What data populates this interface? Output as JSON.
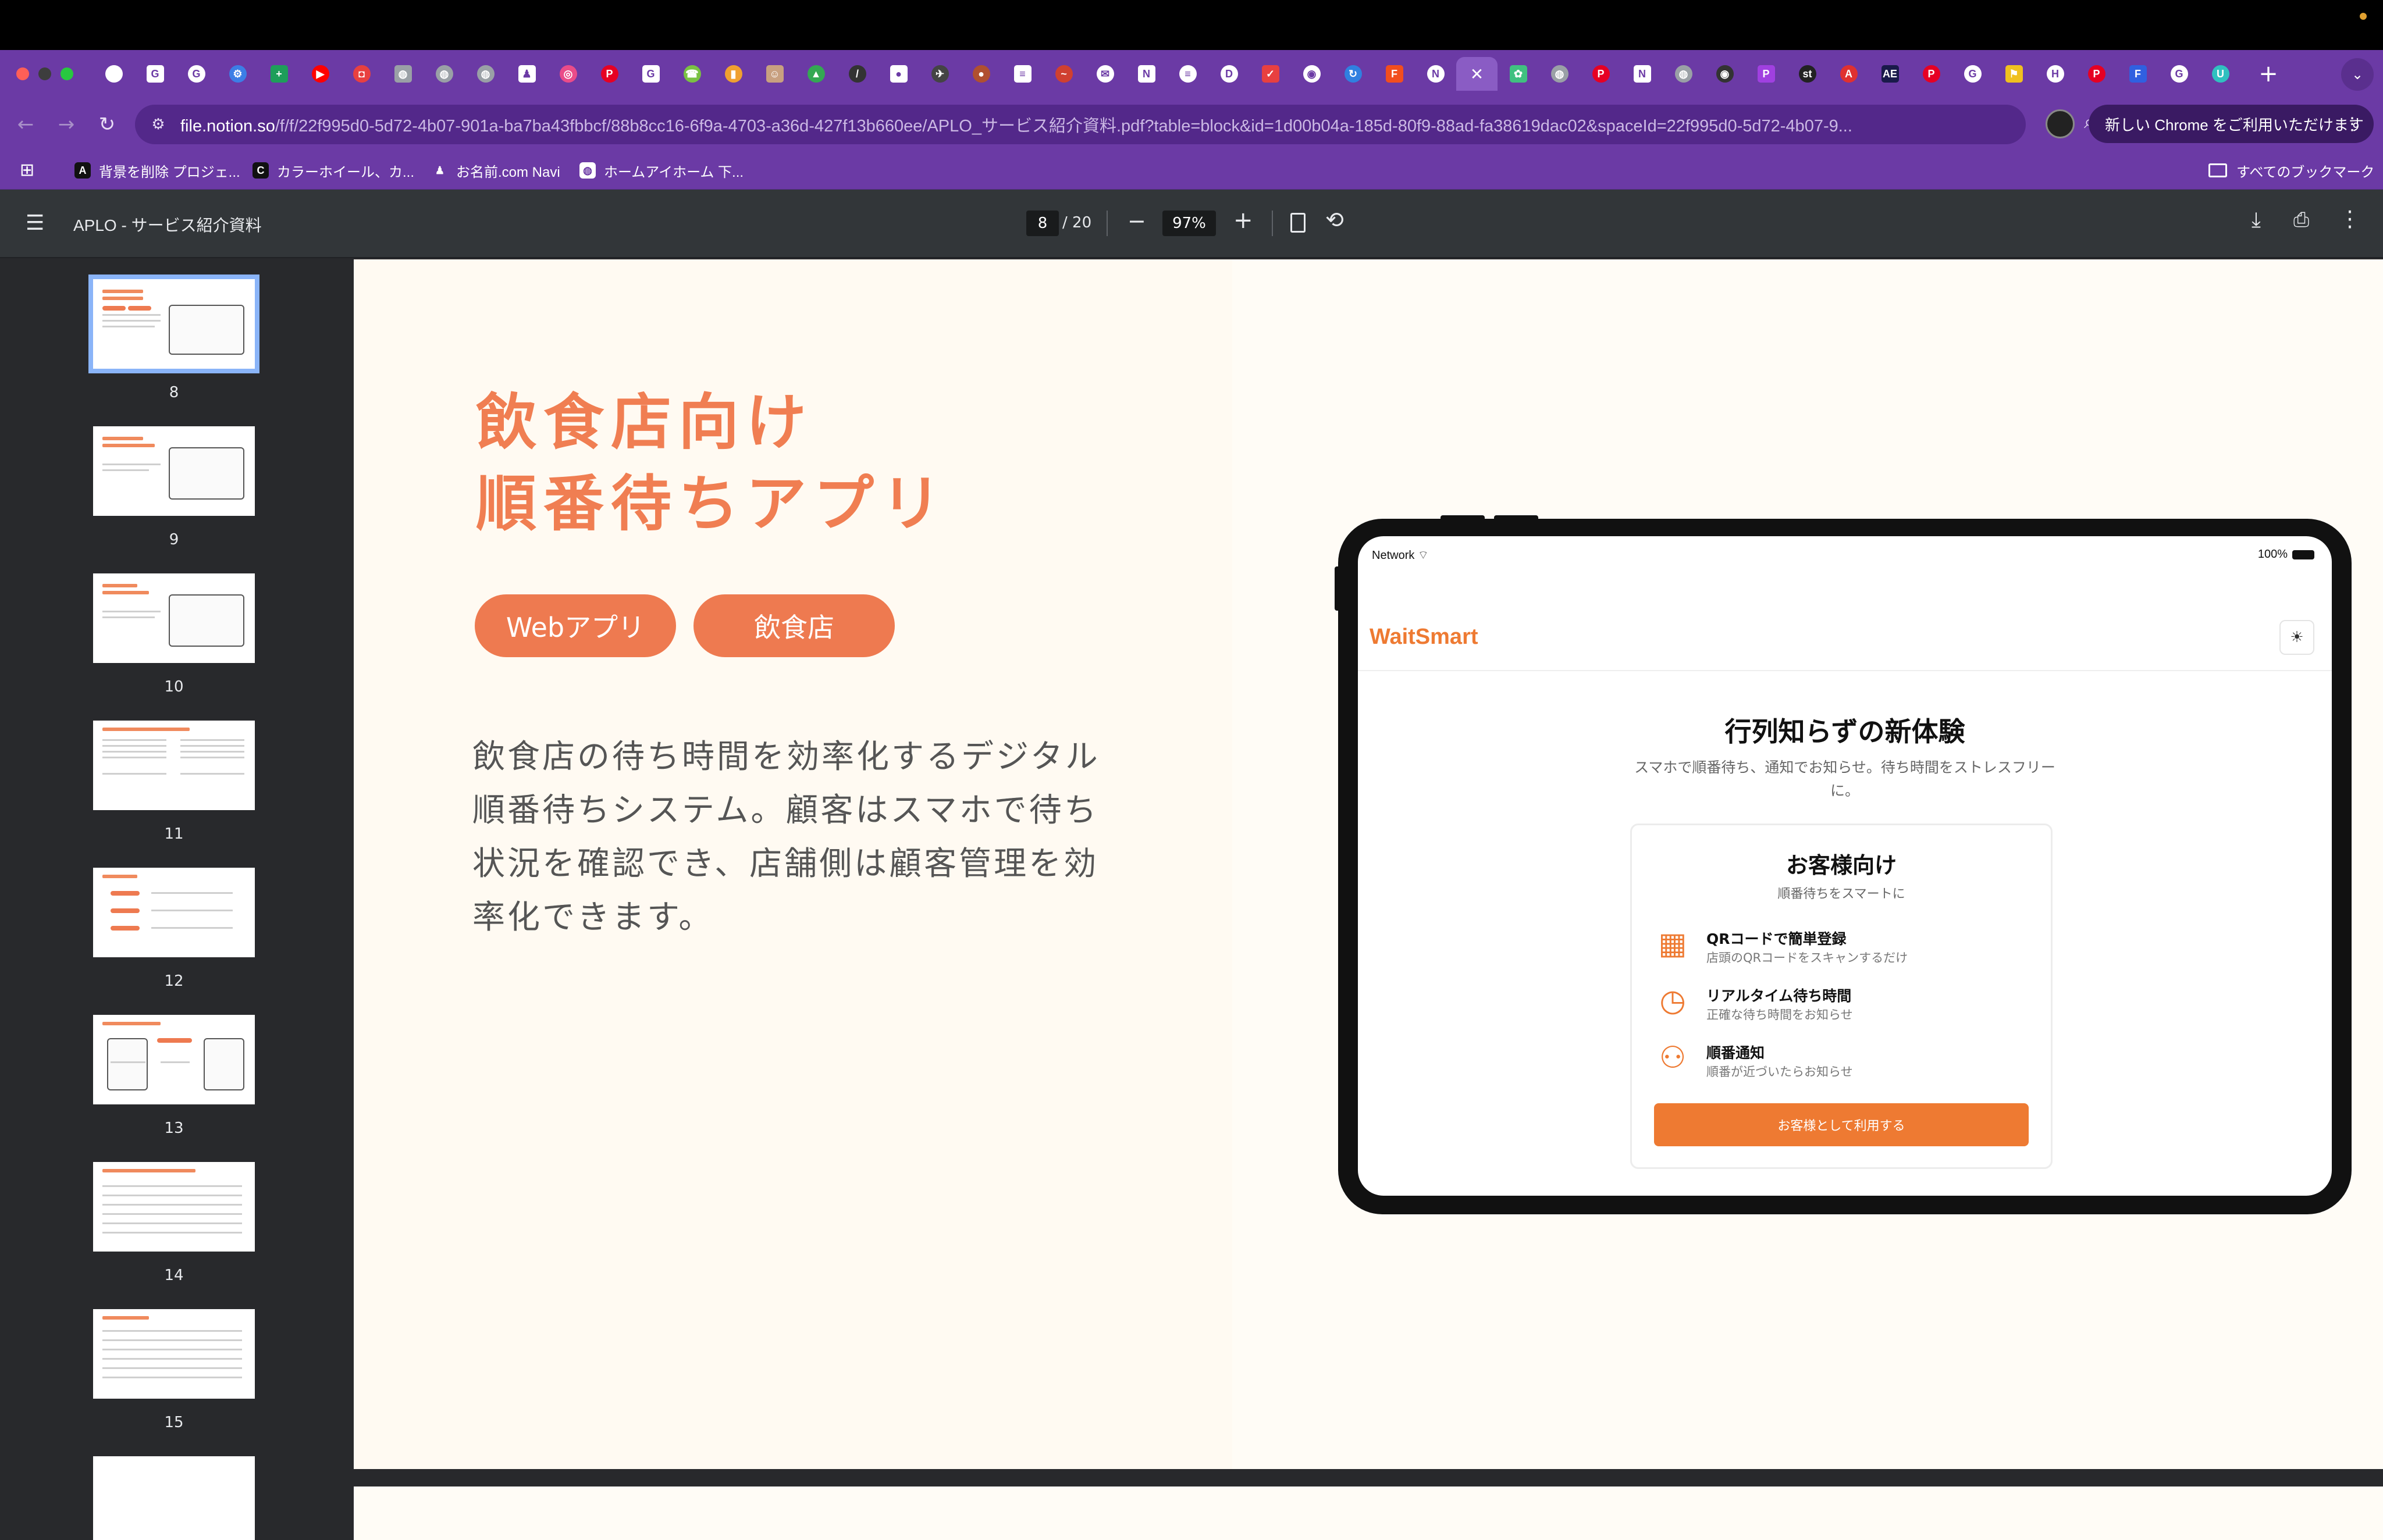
{
  "browser": {
    "tabs": [
      {
        "icon": "chrome-icon",
        "color": "#ffffff",
        "glyph": ""
      },
      {
        "icon": "google-icon",
        "color": "#ffffff",
        "glyph": "G"
      },
      {
        "icon": "google-icon",
        "color": "#ffffff",
        "glyph": "G"
      },
      {
        "icon": "tool-icon",
        "color": "#3c7ee6",
        "glyph": "⚙"
      },
      {
        "icon": "sheets-icon",
        "color": "#1e9e5a",
        "glyph": "+"
      },
      {
        "icon": "youtube-icon",
        "color": "#ff0000",
        "glyph": "▶"
      },
      {
        "icon": "app-icon",
        "color": "#e84040",
        "glyph": "◘"
      },
      {
        "icon": "globe-icon",
        "color": "#9aa0a6",
        "glyph": "◍"
      },
      {
        "icon": "globe-icon",
        "color": "#9aa0a6",
        "glyph": "◍"
      },
      {
        "icon": "globe-icon",
        "color": "#9aa0a6",
        "glyph": "◍"
      },
      {
        "icon": "person-icon",
        "color": "#ffffff",
        "glyph": "♟"
      },
      {
        "icon": "dribbble-icon",
        "color": "#ea4c89",
        "glyph": "◎"
      },
      {
        "icon": "pinterest-icon",
        "color": "#e60023",
        "glyph": "P"
      },
      {
        "icon": "google-icon",
        "color": "#ffffff",
        "glyph": "G"
      },
      {
        "icon": "phone-icon",
        "color": "#7ac143",
        "glyph": "☎"
      },
      {
        "icon": "bookmark-icon",
        "color": "#f0a030",
        "glyph": "▮"
      },
      {
        "icon": "avatar-icon",
        "color": "#c8a080",
        "glyph": "☺"
      },
      {
        "icon": "drive-icon",
        "color": "#34a853",
        "glyph": "▲"
      },
      {
        "icon": "pen-icon",
        "color": "#333333",
        "glyph": "/"
      },
      {
        "icon": "circle-icon",
        "color": "#ffffff",
        "glyph": "●"
      },
      {
        "icon": "bird-icon",
        "color": "#444444",
        "glyph": "✈"
      },
      {
        "icon": "ball-icon",
        "color": "#b05030",
        "glyph": "●"
      },
      {
        "icon": "doc-icon",
        "color": "#ffffff",
        "glyph": "≡"
      },
      {
        "icon": "wave-icon",
        "color": "#d04030",
        "glyph": "~"
      },
      {
        "icon": "mail-icon",
        "color": "#ffffff",
        "glyph": "✉"
      },
      {
        "icon": "notion-icon",
        "color": "#ffffff",
        "glyph": "N"
      },
      {
        "icon": "doc-icon",
        "color": "#ffffff",
        "glyph": "≡"
      },
      {
        "icon": "letter-d-icon",
        "color": "#ffffff",
        "glyph": "D"
      },
      {
        "icon": "check-icon",
        "color": "#e84040",
        "glyph": "✓"
      },
      {
        "icon": "radio-icon",
        "color": "#ffffff",
        "glyph": "◉"
      },
      {
        "icon": "refresh-icon",
        "color": "#3080e0",
        "glyph": "↻"
      },
      {
        "icon": "figma-icon",
        "color": "#f24e1e",
        "glyph": "F"
      },
      {
        "icon": "notion-icon",
        "color": "#ffffff",
        "glyph": "N"
      },
      {
        "icon": "close-icon",
        "color": "#ffffff",
        "glyph": "✕",
        "active": true
      },
      {
        "icon": "leaf-icon",
        "color": "#40c080",
        "glyph": "✿"
      },
      {
        "icon": "globe-icon",
        "color": "#9aa0a6",
        "glyph": "◍"
      },
      {
        "icon": "pinterest-icon",
        "color": "#e60023",
        "glyph": "P"
      },
      {
        "icon": "notion-icon",
        "color": "#ffffff",
        "glyph": "N"
      },
      {
        "icon": "globe-icon",
        "color": "#9aa0a6",
        "glyph": "◍"
      },
      {
        "icon": "github-icon",
        "color": "#333333",
        "glyph": "◉"
      },
      {
        "icon": "p-icon",
        "color": "#a040e0",
        "glyph": "P"
      },
      {
        "icon": "st-icon",
        "color": "#222222",
        "glyph": "st"
      },
      {
        "icon": "adobe-icon",
        "color": "#e03030",
        "glyph": "A"
      },
      {
        "icon": "ae-icon",
        "color": "#1a1a4a",
        "glyph": "AE"
      },
      {
        "icon": "pinterest-icon",
        "color": "#e60023",
        "glyph": "P"
      },
      {
        "icon": "google-icon",
        "color": "#ffffff",
        "glyph": "G"
      },
      {
        "icon": "flag-icon",
        "color": "#f0c020",
        "glyph": "⚑"
      },
      {
        "icon": "h-icon",
        "color": "#ffffff",
        "glyph": "H"
      },
      {
        "icon": "pinterest-icon",
        "color": "#e60023",
        "glyph": "P"
      },
      {
        "icon": "forms-icon",
        "color": "#3060e0",
        "glyph": "F"
      },
      {
        "icon": "google-icon",
        "color": "#ffffff",
        "glyph": "G"
      },
      {
        "icon": "u-icon",
        "color": "#30c0c0",
        "glyph": "U"
      }
    ],
    "new_tab": "+",
    "url_host": "file.notion.so",
    "url_path": "/f/f/22f995d0-5d72-4b07-901a-ba7ba43fbbcf/88b8cc16-6f9a-4703-a36d-427f13b660ee/APLO_サービス紹介資料.pdf?table=block&id=1d00b04a-185d-80f9-88ad-fa38619dac02&spaceId=22f995d0-5d72-4b07-9...",
    "chrome_promo": "新しい Chrome をご利用いただけます",
    "bookmarks": [
      {
        "label": "背景を削除 プロジェ...",
        "icon": "letter-a-icon",
        "color": "#111111",
        "glyph": "A"
      },
      {
        "label": "カラーホイール、カ...",
        "icon": "c-icon",
        "color": "#111111",
        "glyph": "C"
      },
      {
        "label": "お名前.com Navi",
        "icon": "person-icon",
        "color": "#6b3aa5",
        "glyph": "♟"
      },
      {
        "label": "ホームアイホーム 下...",
        "icon": "globe-icon",
        "color": "#ffffff",
        "glyph": "◍"
      }
    ],
    "all_bookmarks": "すべてのブックマーク"
  },
  "pdf_viewer": {
    "title": "APLO - サービス紹介資料",
    "current_page": "8",
    "total_pages": "/ 20",
    "zoom": "97%",
    "thumbnails": [
      {
        "label": "8",
        "selected": true
      },
      {
        "label": "9"
      },
      {
        "label": "10"
      },
      {
        "label": "11"
      },
      {
        "label": "12"
      },
      {
        "label": "13"
      },
      {
        "label": "14"
      },
      {
        "label": "15"
      }
    ]
  },
  "slide": {
    "headline_line1": "飲食店向け",
    "headline_line2": "順番待ちアプリ",
    "tags": [
      "Webアプリ",
      "飲食店"
    ],
    "description": "飲食店の待ち時間を効率化するデジタル順番待ちシステム。顧客はスマホで待ち状況を確認でき、店舗側は顧客管理を効率化できます。",
    "accent_color": "#ee7a50"
  },
  "app_mockup": {
    "status_network": "Network",
    "status_battery": "100%",
    "brand": "WaitSmart",
    "hero_title": "行列知らずの新体験",
    "hero_subtitle": "スマホで順番待ち、通知でお知らせ。待ち時間をストレスフリーに。",
    "card_title": "お客様向け",
    "card_subtitle": "順番待ちをスマートに",
    "features": [
      {
        "icon": "qr-code-icon",
        "title": "QRコードで簡単登録",
        "desc": "店頭のQRコードをスキャンするだけ"
      },
      {
        "icon": "clock-icon",
        "title": "リアルタイム待ち時間",
        "desc": "正確な待ち時間をお知らせ"
      },
      {
        "icon": "users-icon",
        "title": "順番通知",
        "desc": "順番が近づいたらお知らせ"
      }
    ],
    "cta": "お客様として利用する",
    "brand_color": "#ee7a32"
  }
}
